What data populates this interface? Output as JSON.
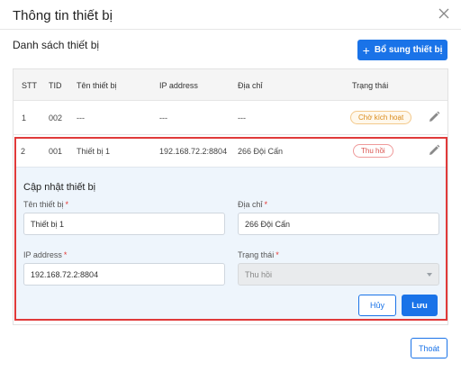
{
  "dialog": {
    "title": "Thông tin thiết bị",
    "close_icon": "close-icon"
  },
  "section": {
    "title": "Danh sách thiết bị",
    "add_button": "Bổ sung thiết bị",
    "add_icon": "plus-icon",
    "accent_color": "#1a73e8"
  },
  "table": {
    "headers": [
      "STT",
      "TID",
      "Tên thiết bị",
      "IP address",
      "Địa chỉ",
      "Trạng thái"
    ],
    "rows": [
      {
        "stt": "1",
        "tid": "002",
        "name": "---",
        "ip": "---",
        "address": "---",
        "status": "Chờ kích hoạt",
        "edit_icon": "pencil-icon"
      },
      {
        "stt": "2",
        "tid": "001",
        "name": "Thiết bị 1",
        "ip": "192.168.72.2:8804",
        "address": "266 Đội Cấn",
        "status": "Thu hồi",
        "edit_icon": "pencil-icon"
      }
    ]
  },
  "edit_form": {
    "title": "Cập nhật thiết bị",
    "name_label": "Tên thiết bị",
    "name_value": "Thiết bị 1",
    "address_label": "Địa chỉ",
    "address_value": "266 Đội Cấn",
    "ip_label": "IP address",
    "ip_value": "192.168.72.2:8804",
    "status_label": "Trạng thái",
    "status_value": "Thu hồi",
    "required_mark": "*",
    "cancel_button": "Hủy",
    "save_button": "Lưu"
  },
  "footer": {
    "exit_button": "Thoát"
  }
}
